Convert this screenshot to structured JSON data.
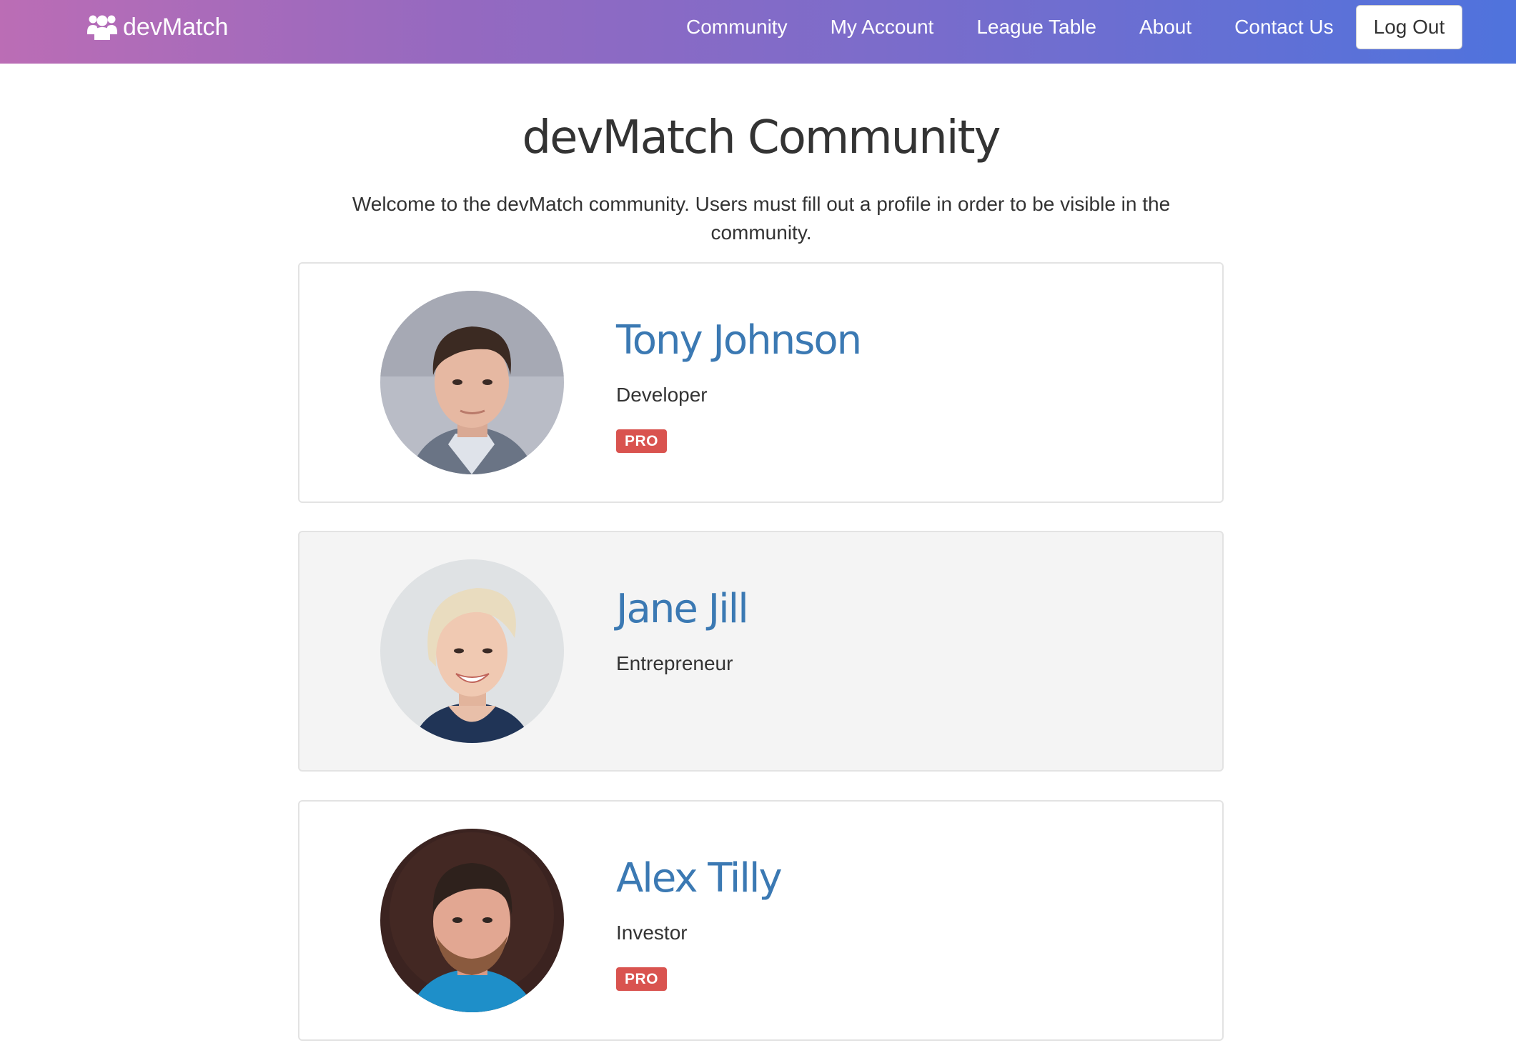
{
  "brand": {
    "name": "devMatch",
    "icon": "users-icon"
  },
  "nav": {
    "links": [
      "Community",
      "My Account",
      "League Table",
      "About",
      "Contact Us"
    ],
    "logout_label": "Log Out"
  },
  "header": {
    "title": "devMatch Community",
    "intro": "Welcome to the devMatch community. Users must fill out a profile in order to be visible in the community."
  },
  "users": [
    {
      "name": "Tony Johnson",
      "role": "Developer",
      "badge": "PRO"
    },
    {
      "name": "Jane Jill",
      "role": "Entrepreneur"
    },
    {
      "name": "Alex Tilly",
      "role": "Investor",
      "badge": "PRO"
    }
  ],
  "colors": {
    "nav_gradient_start": "#bb6db5",
    "nav_gradient_end": "#4f73dd",
    "name_link": "#3b79b3",
    "pro_badge": "#d9534f"
  }
}
